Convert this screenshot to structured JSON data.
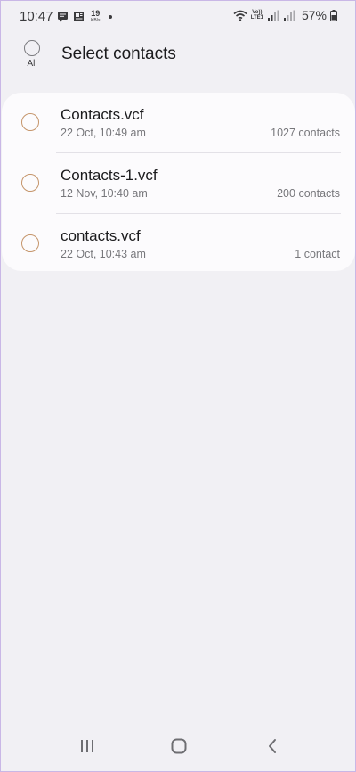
{
  "status_bar": {
    "time": "10:47",
    "net_speed_value": "19",
    "net_speed_unit": "KB/s",
    "volte_top": "Vo))",
    "volte_bottom": "LTE1",
    "battery_percent": "57%"
  },
  "header": {
    "select_all_label": "All",
    "title": "Select contacts"
  },
  "files": [
    {
      "name": "Contacts.vcf",
      "date": "22 Oct, 10:49 am",
      "count": "1027 contacts"
    },
    {
      "name": "Contacts-1.vcf",
      "date": "12 Nov, 10:40 am",
      "count": "200 contacts"
    },
    {
      "name": "contacts.vcf",
      "date": "22 Oct, 10:43 am",
      "count": "1 contact"
    }
  ],
  "colors": {
    "background": "#f1f0f4",
    "card": "#fcfbfd",
    "radio_accent": "#c5956b"
  },
  "icons": {
    "nav_recents": "recent-apps-icon",
    "nav_home": "home-icon",
    "nav_back": "back-icon"
  }
}
